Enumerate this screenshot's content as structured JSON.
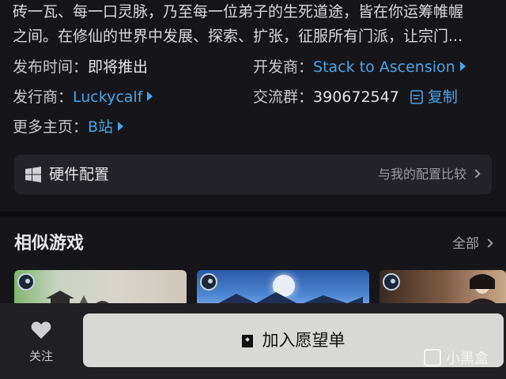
{
  "description": {
    "line1": "砖一瓦、每一口灵脉，乃至每一位弟子的生死道途，皆在你运筹帷幄",
    "line2": "之间。在修仙的世界中发展、探索、扩张，征服所有门派，让宗门..."
  },
  "info": {
    "release_label": "发布时间：",
    "release_value": "即将推出",
    "developer_label": "开发商：",
    "developer_value": "Stack to Ascension",
    "publisher_label": "发行商：",
    "publisher_value": "Luckycalf",
    "group_label": "交流群：",
    "group_value": "390672547",
    "copy_label": "复制",
    "homepage_label": "更多主页：",
    "homepage_value": "B站"
  },
  "hardware": {
    "title": "硬件配置",
    "compare": "与我的配置比较"
  },
  "similar": {
    "title": "相似游戏",
    "all": "全部"
  },
  "bottom_bar": {
    "follow_label": "关注",
    "wishlist_label": "加入愿望单"
  },
  "watermark": "小黑盒",
  "colors": {
    "background": "#16161a",
    "link": "#4ba3e8",
    "card": "#232329",
    "wishlist_button": "#d8d8d6"
  }
}
